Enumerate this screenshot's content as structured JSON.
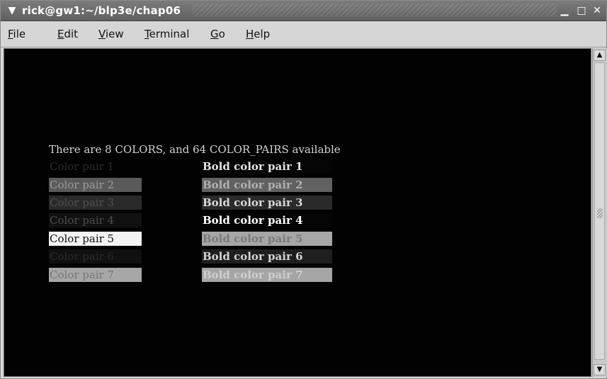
{
  "window": {
    "title": "rick@gw1:~/blp3e/chap06",
    "icons": {
      "menu": "chevron-down-icon",
      "minimize": "minimize-icon",
      "maximize": "maximize-icon",
      "close": "close-icon"
    }
  },
  "menubar": {
    "items": [
      {
        "label": "File",
        "accel": "F",
        "rest": "ile"
      },
      {
        "label": "Edit",
        "accel": "E",
        "rest": "dit"
      },
      {
        "label": "View",
        "accel": "V",
        "rest": "iew"
      },
      {
        "label": "Terminal",
        "accel": "T",
        "rest": "erminal"
      },
      {
        "label": "Go",
        "accel": "G",
        "rest": "o"
      },
      {
        "label": "Help",
        "accel": "H",
        "rest": "elp"
      }
    ]
  },
  "terminal": {
    "header": "There are 8 COLORS, and 64 COLOR_PAIRS available",
    "left_rows": [
      {
        "text": "Color pair 1",
        "fg": "#2b2b2b",
        "bg": "#020202"
      },
      {
        "text": "Color pair 2",
        "fg": "#9c9c9c",
        "bg": "#5a5a5a"
      },
      {
        "text": "Color pair 3",
        "fg": "#4f4f4f",
        "bg": "#2a2a2a"
      },
      {
        "text": "Color pair 4",
        "fg": "#4c4c4c",
        "bg": "#111111"
      },
      {
        "text": "Color pair 5",
        "fg": "#111111",
        "bg": "#f3f3f3"
      },
      {
        "text": "Color pair 6",
        "fg": "#2c2c2c",
        "bg": "#101010"
      },
      {
        "text": "Color pair 7",
        "fg": "#757575",
        "bg": "#a7a7a7"
      }
    ],
    "right_rows": [
      {
        "text": "Bold color pair 1",
        "fg": "#e3e3e3",
        "bg": "#050505"
      },
      {
        "text": "Bold color pair 2",
        "fg": "#b0b0b0",
        "bg": "#616161"
      },
      {
        "text": "Bold color pair 3",
        "fg": "#d8d8d8",
        "bg": "#2a2a2a"
      },
      {
        "text": "Bold color pair 4",
        "fg": "#ffffff",
        "bg": "#050505"
      },
      {
        "text": "Bold color pair 5",
        "fg": "#7a7a7a",
        "bg": "#a6a6a6"
      },
      {
        "text": "Bold color pair 6",
        "fg": "#d4d4d4",
        "bg": "#1f1f1f"
      },
      {
        "text": "Bold color pair 7",
        "fg": "#cfcfcf",
        "bg": "#a5a5a5"
      }
    ]
  },
  "scrollbar": {
    "up_icon": "arrow-up-icon",
    "down_icon": "arrow-down-icon"
  }
}
